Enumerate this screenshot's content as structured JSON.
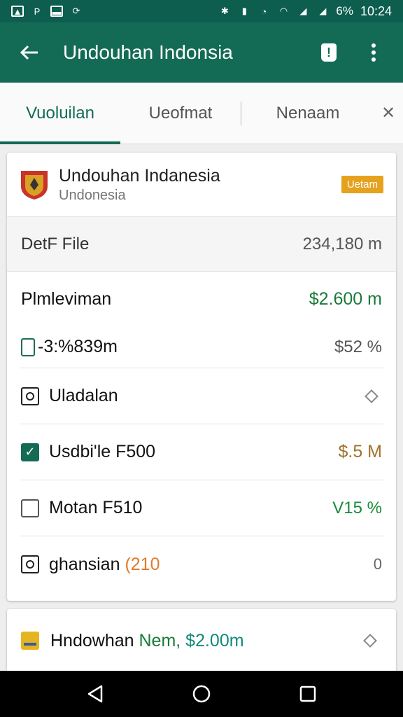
{
  "status_bar": {
    "battery_text": "6%",
    "time": "10:24"
  },
  "app_bar": {
    "title": "Undouhan Indonsia"
  },
  "tabs": [
    {
      "label": "Vuoluilan",
      "active": true
    },
    {
      "label": "Ueofmat",
      "active": false
    },
    {
      "label": "Nenaam",
      "active": false
    }
  ],
  "card": {
    "title": "Undouhan Indanesia",
    "subtitle": "Undonesia",
    "badge": "Uetam",
    "file_row": {
      "label": "DetF File",
      "value": "234,180 m"
    },
    "plan_row": {
      "label": "Plmleviman",
      "value": "$2.600 m"
    },
    "pct_row": {
      "label": "-3:%839m",
      "value": "$52 %"
    },
    "items": [
      {
        "label": "Uladalan",
        "value": ""
      },
      {
        "label": "Usdbi'le F500",
        "value": "$.5 M"
      },
      {
        "label": "Motan F510",
        "value": "V15 %"
      },
      {
        "label": "ghansian",
        "label_extra": "(210",
        "value": "0"
      }
    ]
  },
  "card2": {
    "label": "Hndowhan",
    "label_green": "Nem,",
    "label_teal": "$2.00m"
  },
  "colors": {
    "primary": "#136b55",
    "status_bar": "#0d5e4f",
    "badge": "#e6a21e",
    "positive": "#1a7a3a"
  }
}
